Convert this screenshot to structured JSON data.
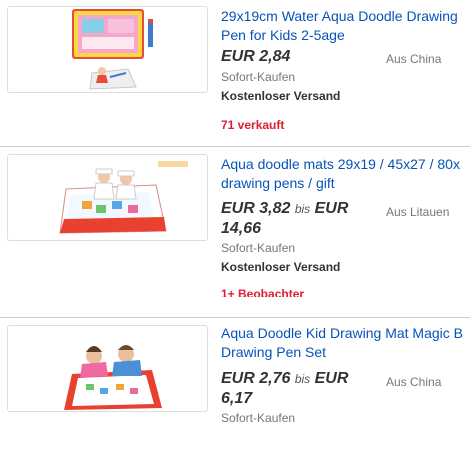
{
  "listings": [
    {
      "title_line1": "29x19cm Water Aqua Doodle Drawing",
      "title_line2": "Pen for Kids 2-5age",
      "price_line1": "EUR 2,84",
      "price_bis": "",
      "price_line1b": "",
      "price_line2": "",
      "origin": "Aus China",
      "format": "Sofort-Kaufen",
      "shipping": "Kostenloser Versand",
      "hotness": "71 verkauft"
    },
    {
      "title_line1": "Aqua doodle mats 29x19 / 45x27 / 80x",
      "title_line2": "drawing pens / gift",
      "price_line1": "EUR 3,82",
      "price_bis": "bis",
      "price_line1b": "EUR",
      "price_line2": "14,66",
      "origin": "Aus Litauen",
      "format": "Sofort-Kaufen",
      "shipping": "Kostenloser Versand",
      "hotness": "1+ Beobachter"
    },
    {
      "title_line1": "Aqua Doodle Kid Drawing Mat Magic B",
      "title_line2": "Drawing Pen Set",
      "price_line1": "EUR 2,76",
      "price_bis": "bis",
      "price_line1b": "EUR",
      "price_line2": "6,17",
      "origin": "Aus China",
      "format": "Sofort-Kaufen",
      "shipping": "",
      "hotness": ""
    }
  ],
  "colors": {
    "link": "#0654ba",
    "price": "#333333",
    "secondary": "#777777",
    "hotness": "#dd1e31",
    "separator": "#cccccc"
  },
  "icons": [
    "doodle-mat-product-image",
    "doodle-mat-kids-product-image",
    "doodle-mat-children-product-image"
  ]
}
